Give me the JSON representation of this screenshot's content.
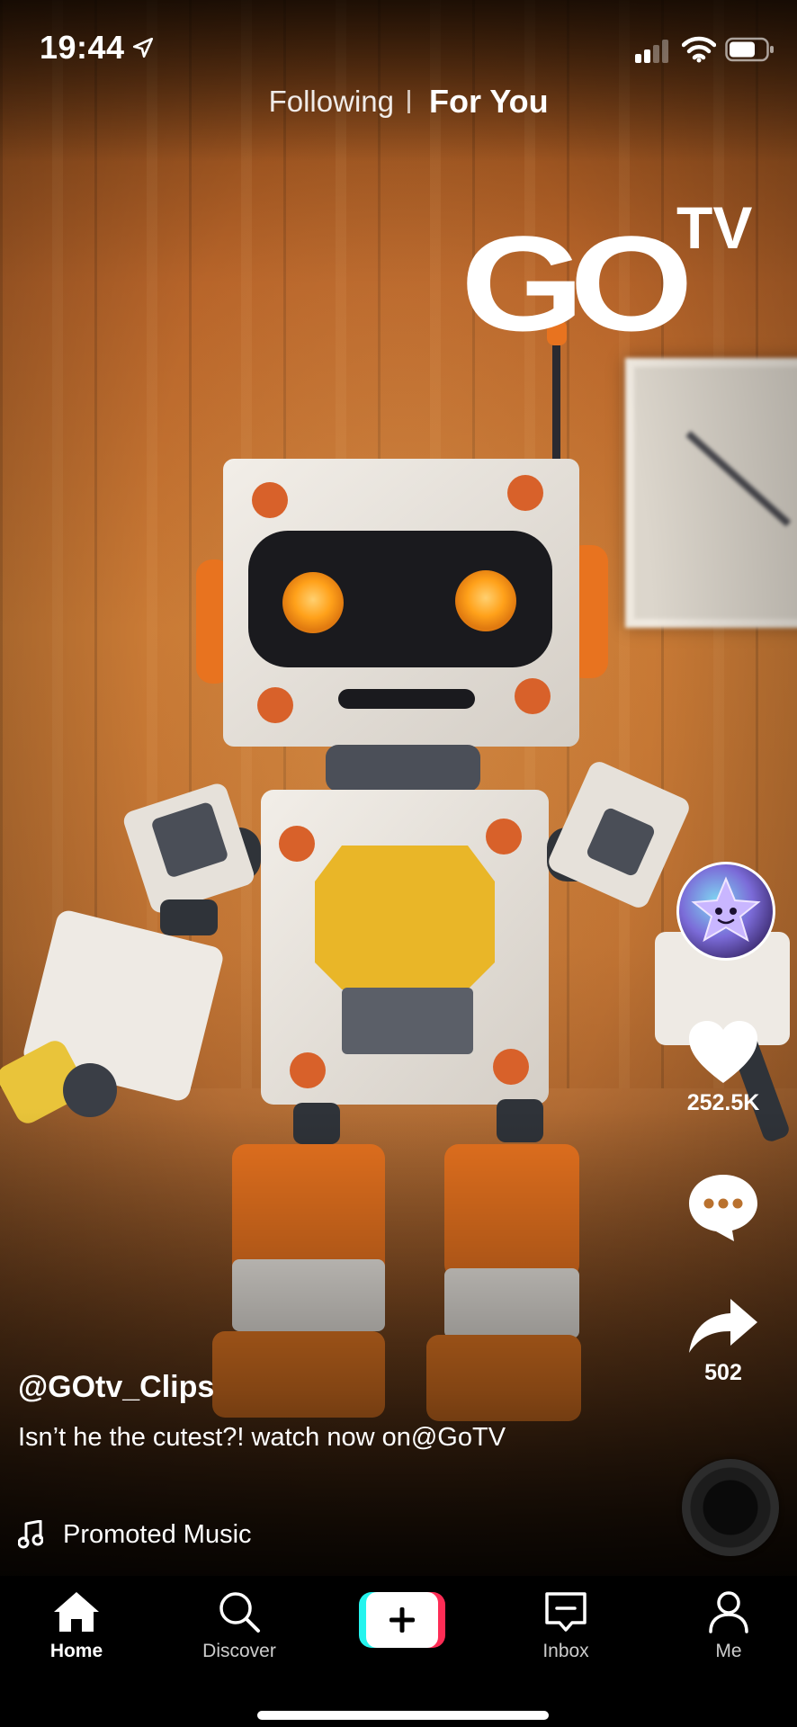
{
  "status_bar": {
    "time": "19:44"
  },
  "top_tabs": {
    "following": "Following",
    "for_you": "For You"
  },
  "video": {
    "logo": {
      "text_main": "GO",
      "text_super": "TV"
    }
  },
  "rail": {
    "likes": "252.5K",
    "shares": "502"
  },
  "caption": {
    "username": "@GOtv_Clips",
    "description": "Isn’t he the cutest?! watch now on@GoTV",
    "music": "Promoted Music"
  },
  "nav": {
    "home": "Home",
    "discover": "Discover",
    "inbox": "Inbox",
    "me": "Me"
  },
  "colors": {
    "create_cyan": "#25f4ee",
    "create_pink": "#fe2c55",
    "robot_orange": "#e8731f",
    "robot_eye": "#ffa11a"
  }
}
